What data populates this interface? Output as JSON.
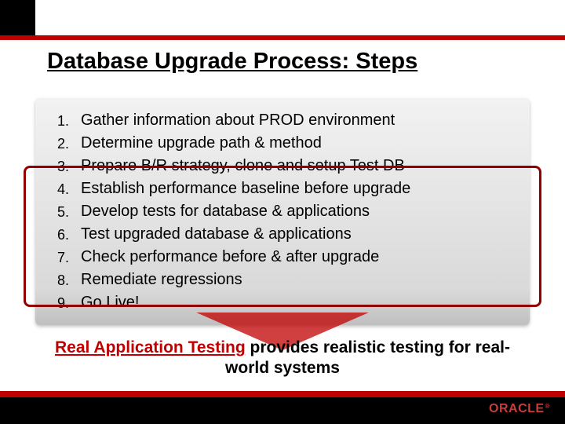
{
  "title": "Database Upgrade Process: Steps",
  "steps": [
    "Gather information about PROD environment",
    "Determine upgrade path & method",
    "Prepare B/R strategy, clone and setup Test DB",
    "Establish performance baseline before upgrade",
    "Develop tests for database & applications",
    "Test upgraded database & applications",
    "Check performance before & after upgrade",
    "Remediate regressions",
    "Go Live!"
  ],
  "callout": {
    "emph": "Real Application Testing",
    "rest": " provides realistic testing for real-world systems"
  },
  "brand": "ORACLE",
  "reg": "®"
}
